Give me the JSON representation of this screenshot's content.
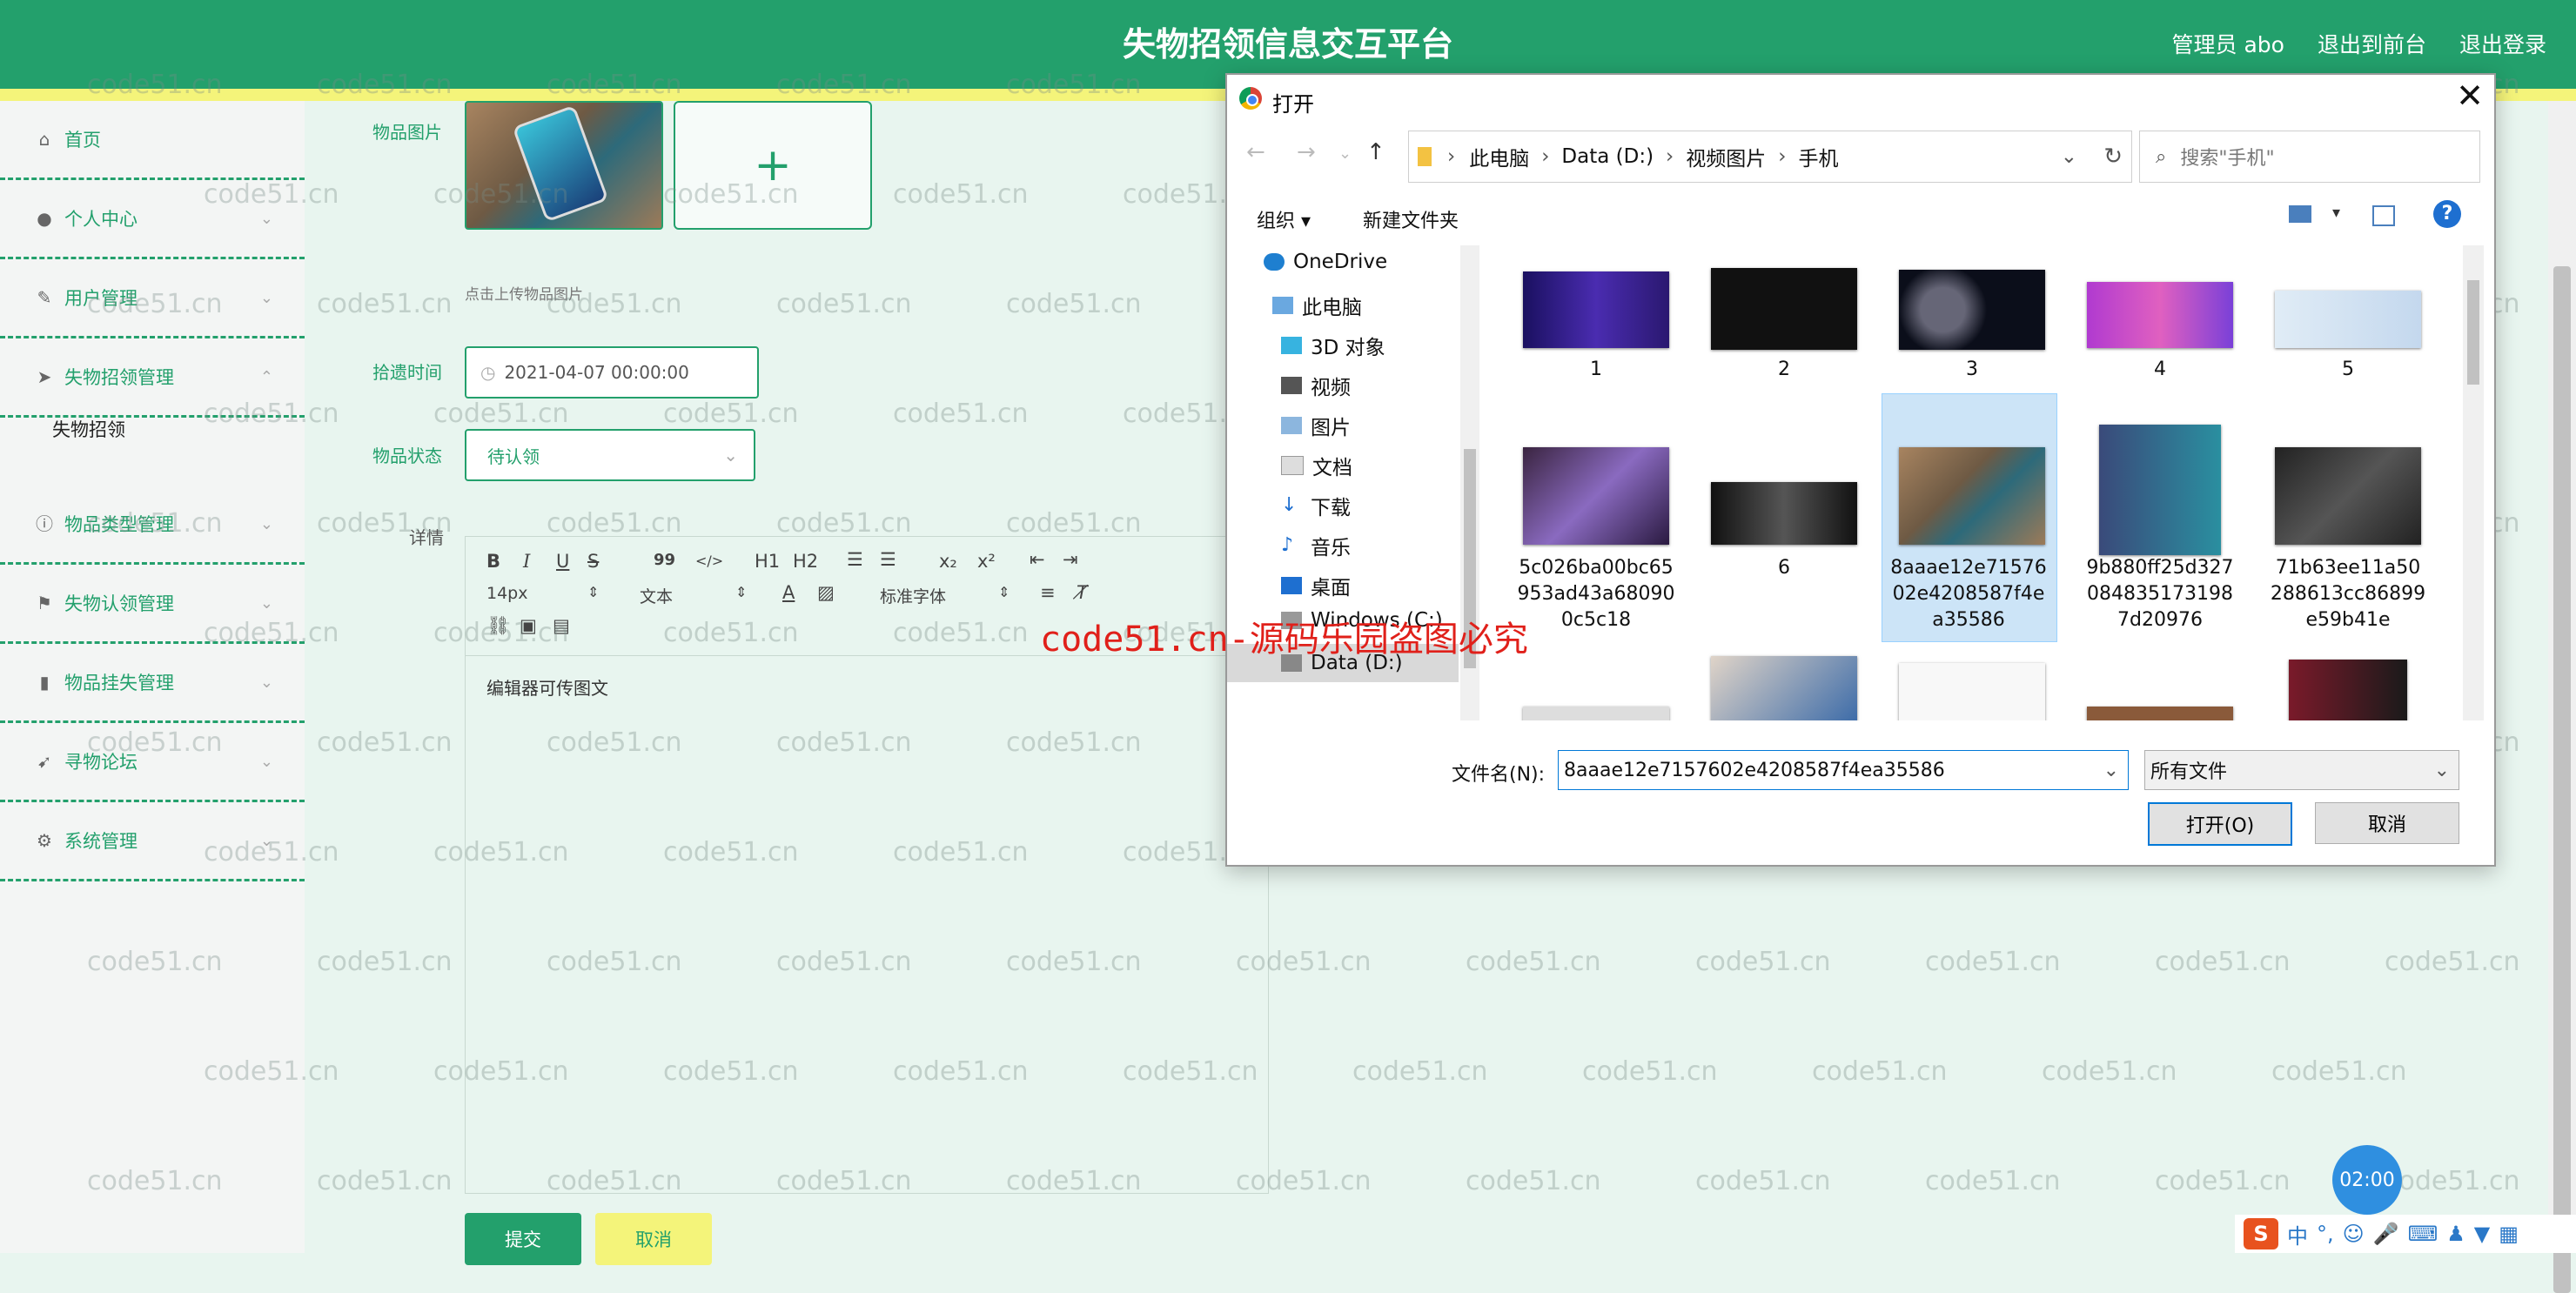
{
  "header": {
    "title": "失物招领信息交互平台",
    "admin_label": "管理员 abo",
    "back_to_front": "退出到前台",
    "logout": "退出登录"
  },
  "sidebar": {
    "items": [
      {
        "label": "首页",
        "icon": "home-icon"
      },
      {
        "label": "个人中心",
        "icon": "user-icon"
      },
      {
        "label": "用户管理",
        "icon": "edit-icon"
      },
      {
        "label": "失物招领管理",
        "icon": "send-icon"
      },
      {
        "label": "物品类型管理",
        "icon": "info-icon"
      },
      {
        "label": "失物认领管理",
        "icon": "flag-icon"
      },
      {
        "label": "物品挂失管理",
        "icon": "bar-chart-icon"
      },
      {
        "label": "寻物论坛",
        "icon": "navigation-icon"
      },
      {
        "label": "系统管理",
        "icon": "gear-icon"
      }
    ],
    "sub_item": "失物招领"
  },
  "form": {
    "image_label": "物品图片",
    "upload_hint": "点击上传物品图片",
    "upload_plus": "+",
    "time_label": "拾遗时间",
    "time_value": "2021-04-07 00:00:00",
    "status_label": "物品状态",
    "status_value": "待认领",
    "detail_label": "详情",
    "editor_placeholder": "编辑器可传图文",
    "toolbar": {
      "bold": "B",
      "italic": "I",
      "underline": "U",
      "strike": "S",
      "quote": "99",
      "code": "</>",
      "h1": "H1",
      "h2": "H2",
      "sub": "x₂",
      "sup": "x²",
      "font_size": "14px",
      "text_type": "文本",
      "font_family": "标准字体"
    },
    "submit": "提交",
    "cancel": "取消"
  },
  "watermark": {
    "text": "code51.cn",
    "red": "code51.cn-源码乐园盗图必究"
  },
  "dialog": {
    "title": "打开",
    "close": "✕",
    "path": [
      "此电脑",
      "Data (D:)",
      "视频图片",
      "手机"
    ],
    "search_placeholder": "搜索\"手机\"",
    "organize": "组织 ▾",
    "new_folder": "新建文件夹",
    "tree": [
      "OneDrive",
      "此电脑",
      "3D 对象",
      "视频",
      "图片",
      "文档",
      "下载",
      "音乐",
      "桌面",
      "Windows (C:)",
      "Data (D:)"
    ],
    "files_row1": [
      "1",
      "2",
      "3",
      "4",
      "5"
    ],
    "files_row2": [
      "5c026ba00bc65953ad43a680900c5c18",
      "6",
      "8aaae12e7157602e4208587f4ea35586",
      "9b880ff25d327084835173198 7d20976",
      "71b63ee11a50288613cc86899e59b41e"
    ],
    "files_row2_display": [
      "5c026ba00bc65\n953ad43a68090\n0c5c18",
      "6",
      "8aaae12e71576\n02e4208587f4e\na35586",
      "9b880ff25d327\n084835173198\n7d20976",
      "71b63ee11a50\n288613cc86899\ne59b41e"
    ],
    "filename_label": "文件名(N):",
    "filename_value": "8aaae12e7157602e4208587f4ea35586",
    "filetype": "所有文件",
    "open_button": "打开(O)",
    "cancel_button": "取消"
  },
  "taskbar": {
    "clock": "02:00",
    "ime": "中"
  }
}
